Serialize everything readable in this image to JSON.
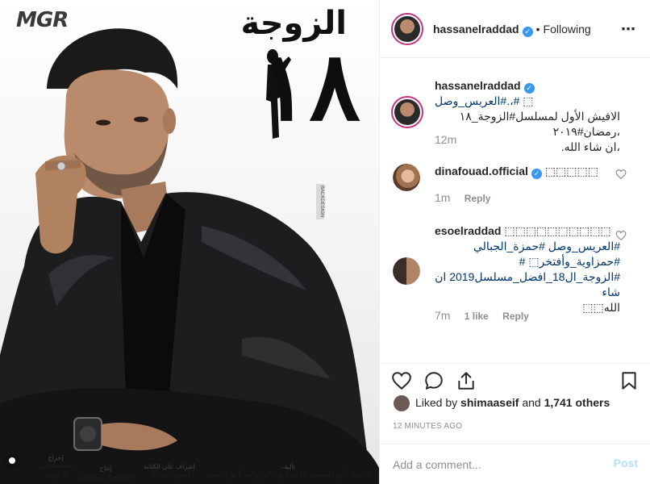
{
  "poster": {
    "logo": "MGR",
    "title_ar": "الزوجة",
    "title_num": "١٨",
    "side_badge": "BACKDESIGN",
    "credits": [
      {
        "role": "إخراج",
        "name": "مصطفى فكري"
      },
      {
        "role": "إشراف على الكتابة",
        "name": "أيمن جمال"
      },
      {
        "role": "إنتاج",
        "name": "ممدوح شاهين"
      },
      {
        "role": "تأليف",
        "name": "محمد أبو السعد  خالد أبو بكر  وليد أبو المجد"
      }
    ]
  },
  "header": {
    "username": "hassanelraddad",
    "verified_icon": "verified-badge-icon",
    "separator": "•",
    "follow_status": "Following",
    "more_icon": "⋯"
  },
  "comments": [
    {
      "username": "hassanelraddad",
      "verified": true,
      "lines": [
        "العريس_وصل#.،# ⬚",
        "الافيش الأول لمسلسل#الزوجة_١٨ ،رمضان#٢٠١٩",
        "،ان شاء الله."
      ],
      "time": "12m"
    },
    {
      "username": "dinafouad.official",
      "verified": true,
      "text": "⬚⬚⬚⬚⬚",
      "time": "1m",
      "reply": "Reply"
    },
    {
      "username": "esoelraddad",
      "verified": false,
      "lines": [
        "⬚⬚⬚⬚⬚⬚⬚⬚⬚⬚",
        "#العريس_وصل #حمزة_الجبالي",
        "#حمزاوية_وأفتخر⬚ #",
        "#الزوجة_ال18_افضل_مسلسل2019 ان شاء",
        "الله⬚⬚"
      ],
      "time": "7m",
      "likes": "1 like",
      "reply": "Reply"
    }
  ],
  "actions": {
    "liked_prefix": "Liked by",
    "liked_user": "shimaaseif",
    "liked_suffix": "and",
    "liked_others": "1,741 others",
    "timestamp": "12 MINUTES AGO"
  },
  "add_comment": {
    "placeholder": "Add a comment...",
    "post_label": "Post"
  },
  "colors": {
    "link": "#00376b",
    "verified": "#3897f0",
    "muted": "#8e8e8e",
    "post_disabled": "#b2dffc",
    "ring": "#c13584"
  }
}
